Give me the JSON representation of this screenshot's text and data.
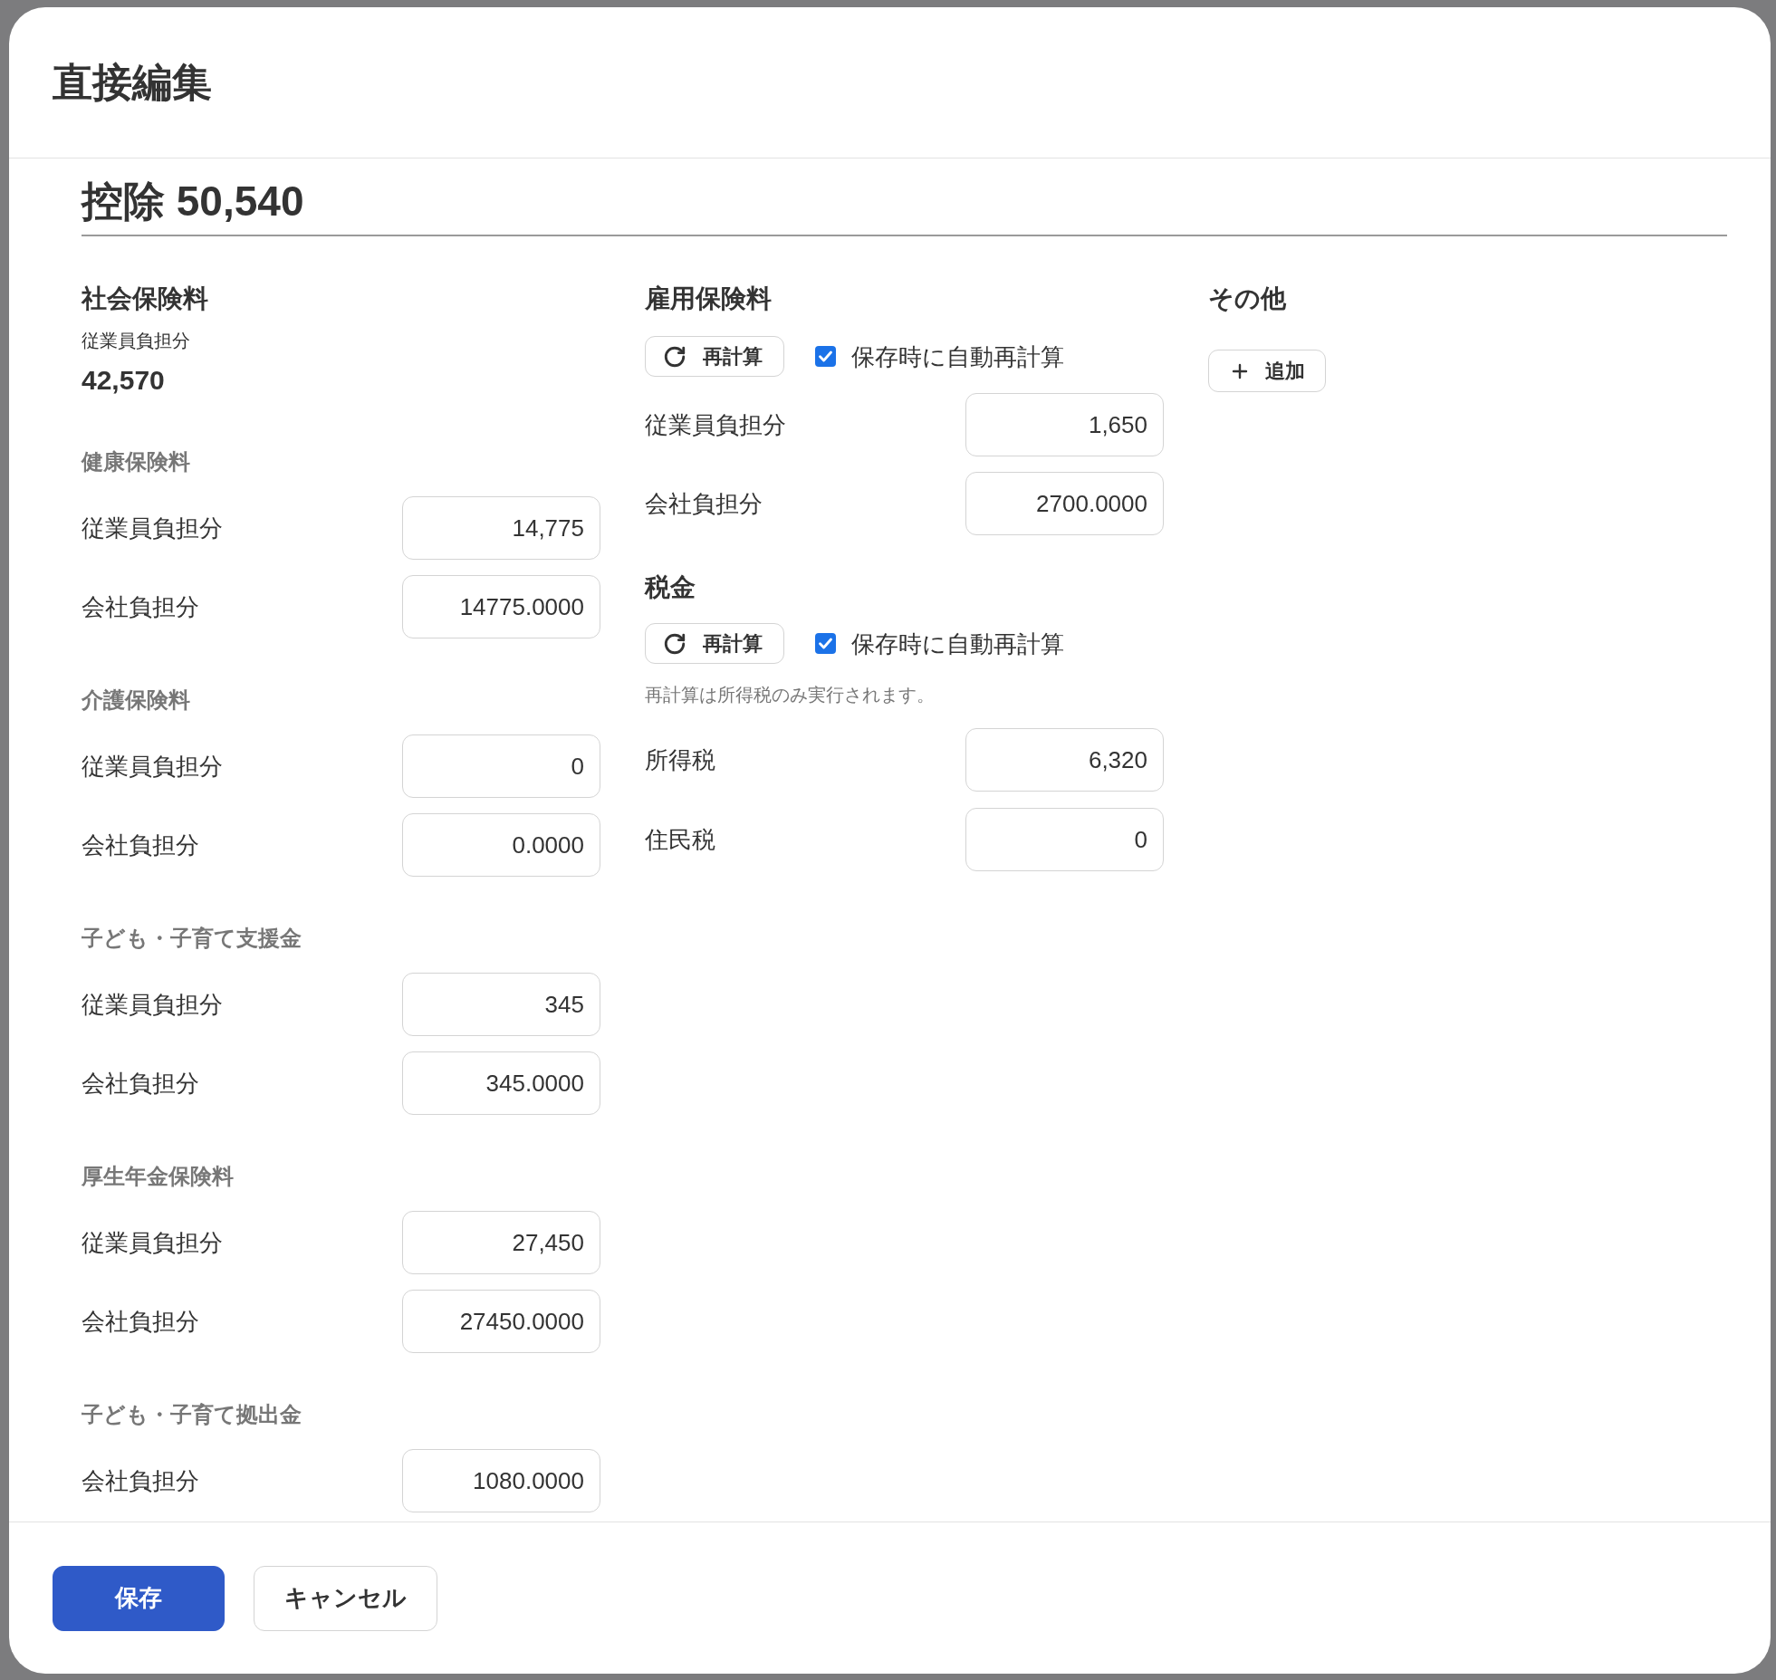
{
  "dialog": {
    "title": "直接編集"
  },
  "deduction": {
    "heading": "控除 50,540"
  },
  "social_insurance": {
    "title": "社会保険料",
    "total_label": "従業員負担分",
    "total_value": "42,570",
    "groups": [
      {
        "title": "健康保険料",
        "fields": [
          {
            "label": "従業員負担分",
            "value": "14,775"
          },
          {
            "label": "会社負担分",
            "value": "14775.0000"
          }
        ]
      },
      {
        "title": "介護保険料",
        "fields": [
          {
            "label": "従業員負担分",
            "value": "0"
          },
          {
            "label": "会社負担分",
            "value": "0.0000"
          }
        ]
      },
      {
        "title": "子ども・子育て支援金",
        "fields": [
          {
            "label": "従業員負担分",
            "value": "345"
          },
          {
            "label": "会社負担分",
            "value": "345.0000"
          }
        ]
      },
      {
        "title": "厚生年金保険料",
        "fields": [
          {
            "label": "従業員負担分",
            "value": "27,450"
          },
          {
            "label": "会社負担分",
            "value": "27450.0000"
          }
        ]
      },
      {
        "title": "子ども・子育て拠出金",
        "fields": [
          {
            "label": "会社負担分",
            "value": "1080.0000"
          }
        ]
      }
    ]
  },
  "employment_insurance": {
    "title": "雇用保険料",
    "recalc_button": "再計算",
    "auto_recalc": {
      "label": "保存時に自動再計算",
      "checked": true
    },
    "fields": [
      {
        "label": "従業員負担分",
        "value": "1,650"
      },
      {
        "label": "会社負担分",
        "value": "2700.0000"
      }
    ]
  },
  "tax": {
    "title": "税金",
    "recalc_button": "再計算",
    "auto_recalc": {
      "label": "保存時に自動再計算",
      "checked": true
    },
    "note": "再計算は所得税のみ実行されます。",
    "fields": [
      {
        "label": "所得税",
        "value": "6,320"
      },
      {
        "label": "住民税",
        "value": "0"
      }
    ]
  },
  "other": {
    "title": "その他",
    "add_button": "追加"
  },
  "footer": {
    "buttons": [
      {
        "label": "保存",
        "kind": "primary"
      },
      {
        "label": "キャンセル",
        "kind": "secondary"
      }
    ]
  }
}
